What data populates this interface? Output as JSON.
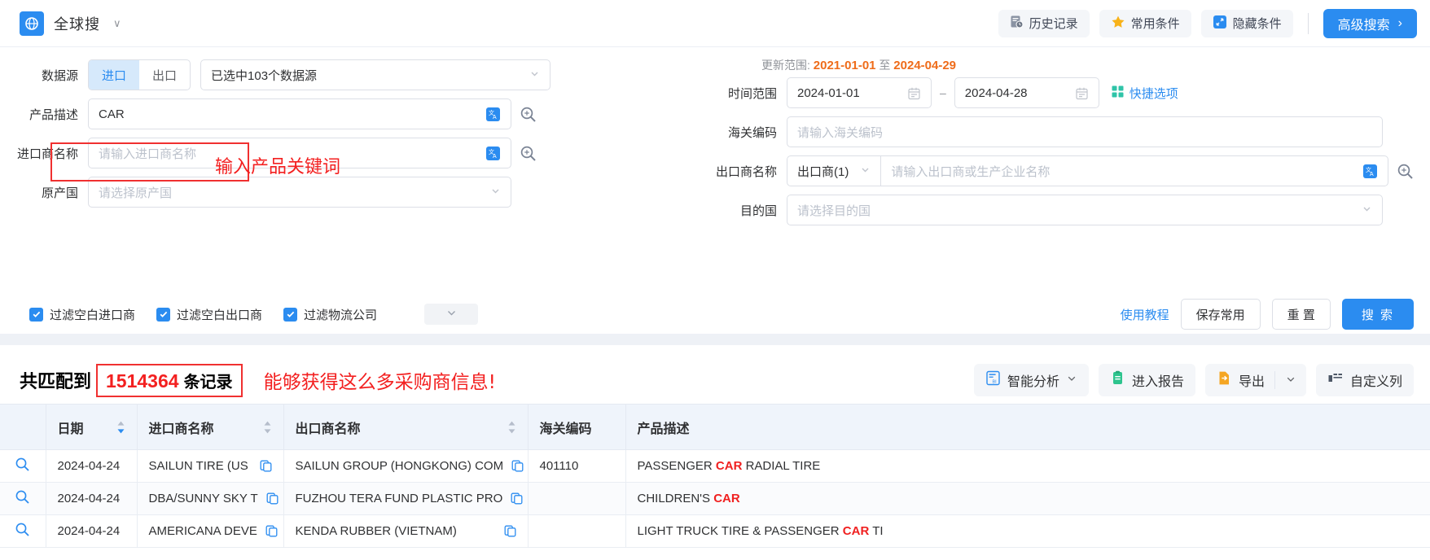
{
  "topbar": {
    "brand_name": "全球搜",
    "brand_icon": "globe-icon",
    "caret": "∨",
    "history_label": "历史记录",
    "favorite_label": "常用条件",
    "hide_label": "隐藏条件",
    "advanced_label": "高级搜索",
    "advanced_arrow": "›"
  },
  "form": {
    "datasource_label": "数据源",
    "seg_import": "进口",
    "seg_export": "出口",
    "datasource_value": "已选中103个数据源",
    "product_label": "产品描述",
    "product_value": "CAR",
    "product_tip": "输入产品关键词",
    "importer_label": "进口商名称",
    "importer_placeholder": "请输入进口商名称",
    "origin_label": "原产国",
    "origin_placeholder": "请选择原产国",
    "update_range_prefix": "更新范围:",
    "update_range_start": "2021-01-01",
    "update_range_mid": "至",
    "update_range_end": "2024-04-29",
    "time_label": "时间范围",
    "date_start": "2024-01-01",
    "date_end": "2024-04-28",
    "date_dash": "–",
    "quick_label": "快捷选项",
    "hscode_label": "海关编码",
    "hscode_placeholder": "请输入海关编码",
    "exporter_label": "出口商名称",
    "exporter_select": "出口商(1)",
    "exporter_placeholder": "请输入出口商或生产企业名称",
    "dest_label": "目的国",
    "dest_placeholder": "请选择目的国"
  },
  "filters": {
    "cb1": "过滤空白进口商",
    "cb2": "过滤空白出口商",
    "cb3": "过滤物流公司",
    "tutorial": "使用教程",
    "save_common": "保存常用",
    "reset": "重 置",
    "search": "搜 索"
  },
  "results": {
    "matched_prefix": "共匹配到",
    "count": "1514364",
    "unit": "条记录",
    "tip": "能够获得这么多采购商信息!",
    "smart_analysis": "智能分析",
    "enter_report": "进入报告",
    "export": "导出",
    "custom_columns": "自定义列"
  },
  "table": {
    "headers": [
      "",
      "日期",
      "进口商名称",
      "出口商名称",
      "海关编码",
      "产品描述"
    ],
    "rows": [
      {
        "date": "2024-04-24",
        "importer": "SAILUN TIRE (US",
        "exporter": "SAILUN GROUP (HONGKONG) COM",
        "hscode": "401110",
        "desc_pre": "PASSENGER ",
        "desc_hl": "CAR",
        "desc_post": " RADIAL TIRE"
      },
      {
        "date": "2024-04-24",
        "importer": "DBA/SUNNY SKY T",
        "exporter": "FUZHOU TERA FUND PLASTIC PRO",
        "hscode": "",
        "desc_pre": "CHILDREN'S ",
        "desc_hl": "CAR",
        "desc_post": ""
      },
      {
        "date": "2024-04-24",
        "importer": "AMERICANA DEVE",
        "exporter": "KENDA RUBBER (VIETNAM)",
        "hscode": "",
        "desc_pre": "LIGHT TRUCK TIRE & PASSENGER ",
        "desc_hl": "CAR",
        "desc_post": " TI"
      }
    ]
  },
  "colors": {
    "accent": "#2b8cf0",
    "highlight_red": "#f02020",
    "orange": "#ef6c1a",
    "header_bg": "#eff4fb"
  }
}
